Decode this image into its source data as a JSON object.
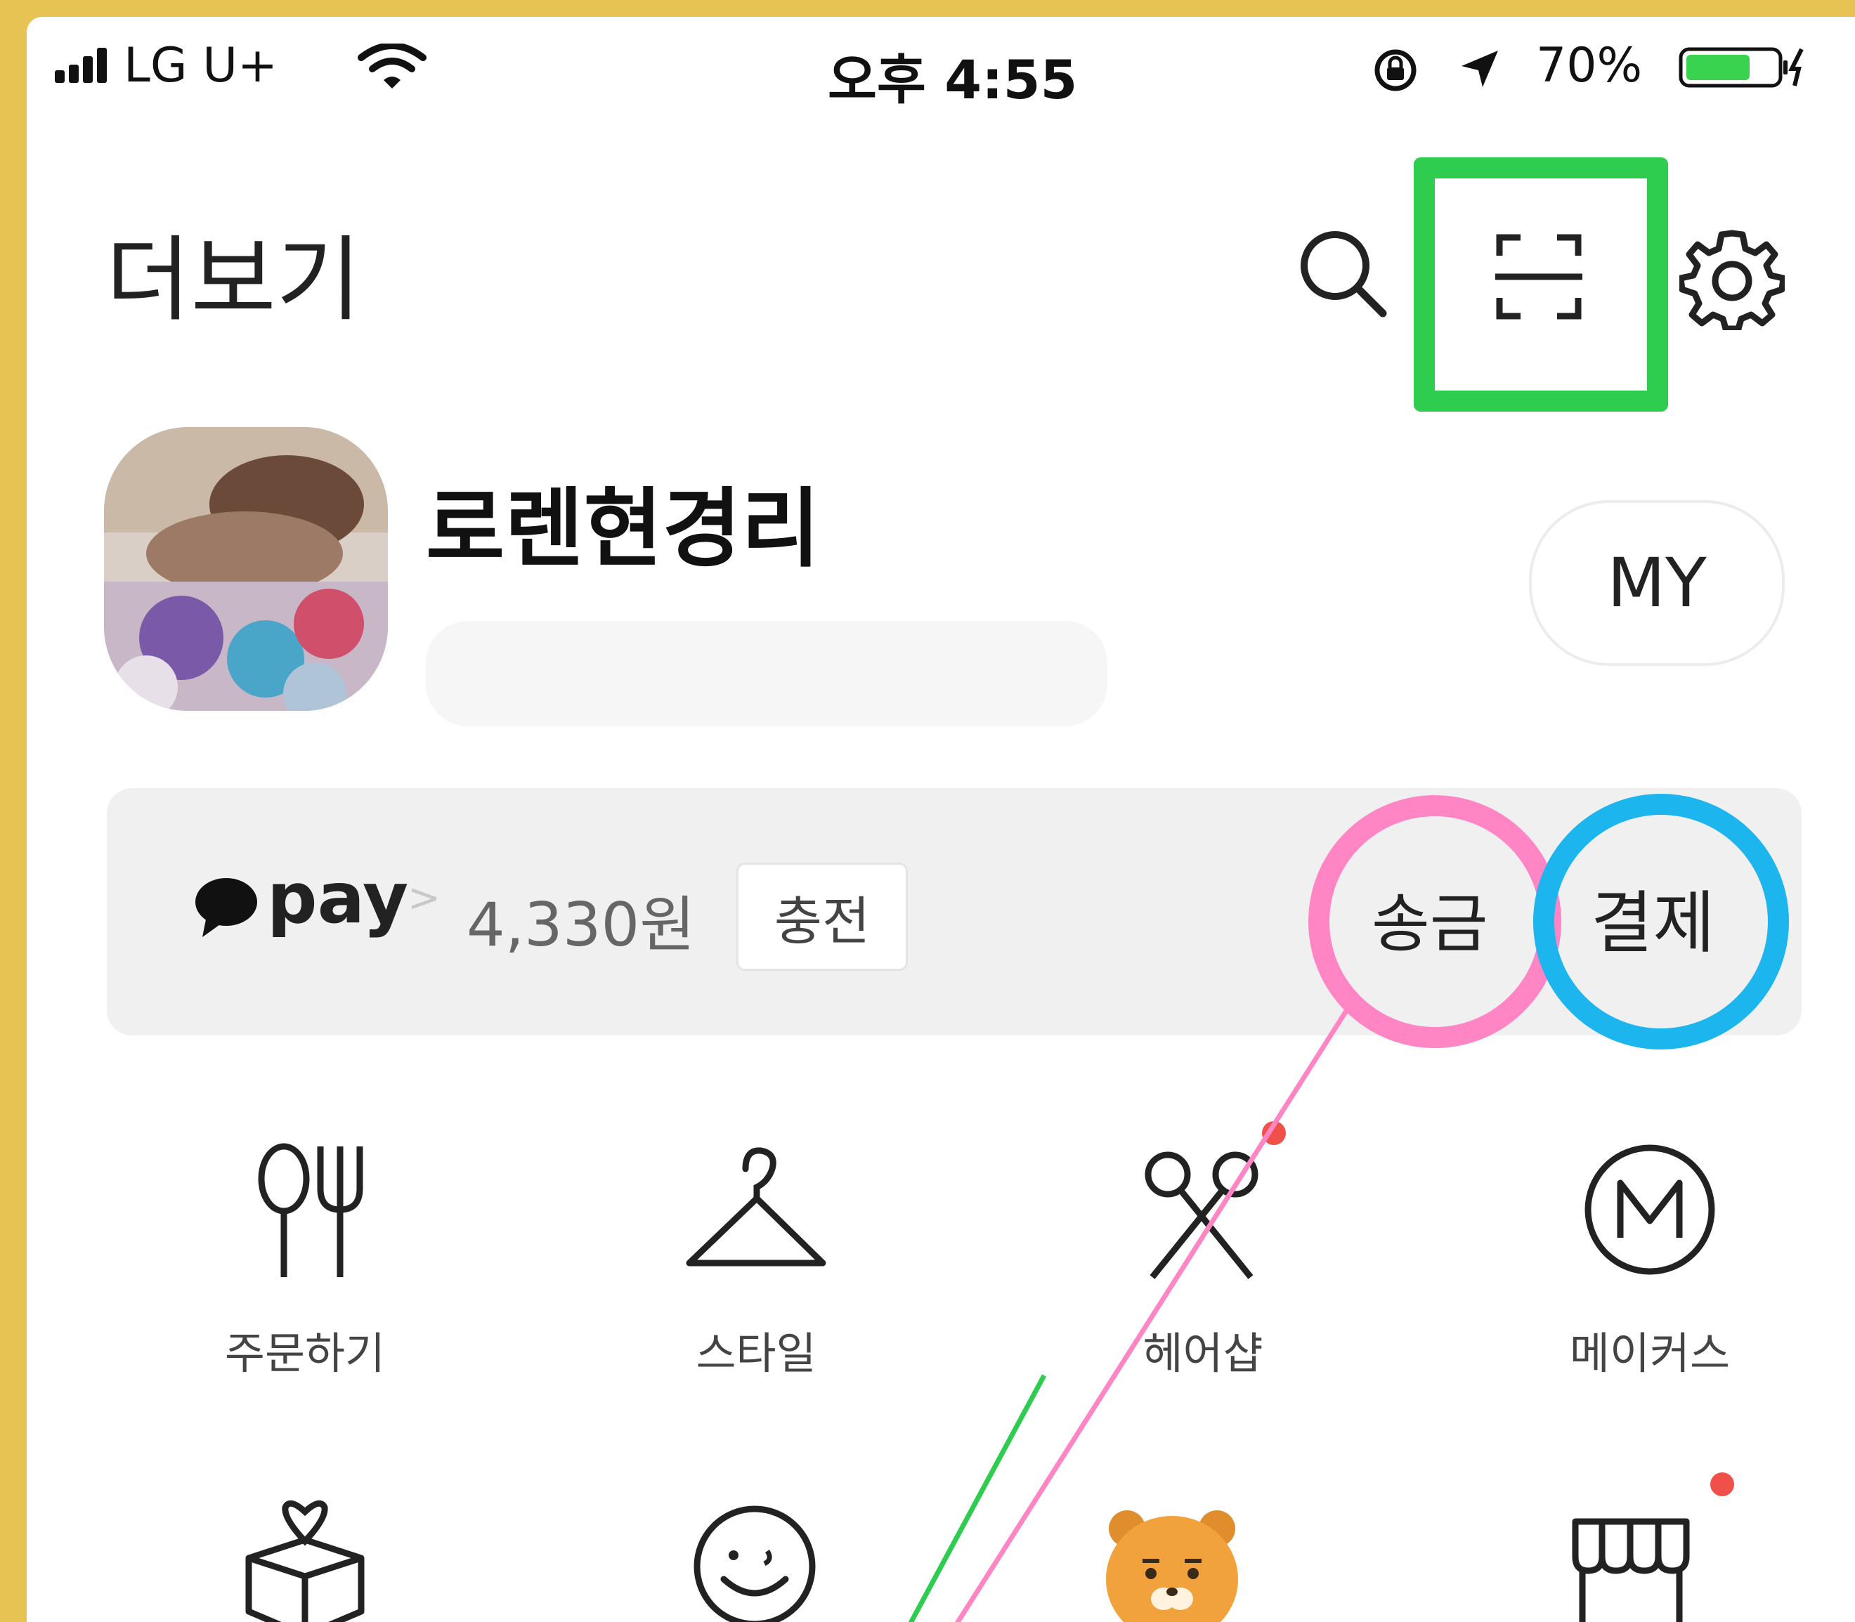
{
  "status_bar": {
    "carrier": "LG U+",
    "time": "오후 4:55",
    "battery_pct": "70%"
  },
  "header": {
    "title": "더보기"
  },
  "profile": {
    "name": "로렌현경리",
    "my_button": "MY"
  },
  "pay_bar": {
    "brand": "pay",
    "chevron": ">",
    "balance": "4,330원",
    "charge_button": "충전",
    "send_button": "송금",
    "pay_button": "결제"
  },
  "categories": [
    {
      "label": "주문하기",
      "icon": "fork-knife-icon",
      "badge": false
    },
    {
      "label": "스타일",
      "icon": "hanger-icon",
      "badge": false
    },
    {
      "label": "헤어샵",
      "icon": "scissors-icon",
      "badge": true
    },
    {
      "label": "메이커스",
      "icon": "makers-m-icon",
      "badge": false
    }
  ],
  "categories_row2_icons": [
    "gift-box-heart-icon",
    "smile-chat-icon",
    "ryan-character-icon",
    "store-icon"
  ],
  "colors": {
    "annotation_green": "#2ecc4f",
    "annotation_pink": "#ff85c4",
    "annotation_blue": "#1cb5ee",
    "badge_red": "#f0504a",
    "battery_green": "#3ad34f",
    "ryan_orange": "#f2a23c",
    "frame_yellow": "#e6c352"
  }
}
